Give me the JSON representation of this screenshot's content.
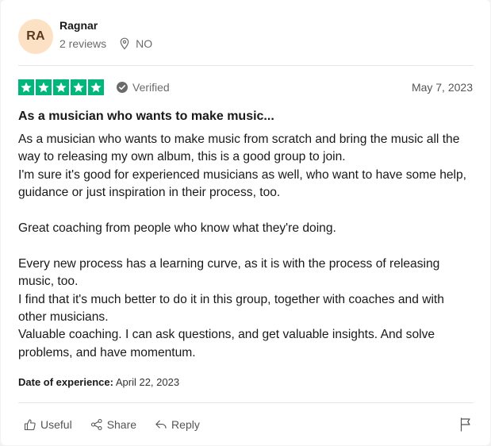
{
  "reviewer": {
    "initials": "RA",
    "name": "Ragnar",
    "reviews_count": "2 reviews",
    "country": "NO",
    "avatar_bg": "#fde1c4"
  },
  "rating": {
    "stars": 5,
    "star_color": "#00b67a",
    "verified_label": "Verified",
    "date": "May 7, 2023"
  },
  "review": {
    "title": "As a musician who wants to make music...",
    "paragraphs": [
      "As a musician who wants to make music from scratch and bring the music all the way to releasing my own album, this is a good group to join.",
      "I'm sure it's good for experienced musicians as well, who want to have some help, guidance or just inspiration in their process, too.",
      "",
      "Great coaching from people who know what they're doing.",
      "",
      "Every new process has a learning curve, as it is with the process of releasing music, too.",
      "I find that it's much better to do it in this group, together with coaches and with other musicians.",
      "Valuable coaching. I can ask questions, and get valuable insights. And solve problems, and have momentum."
    ]
  },
  "experience": {
    "label": "Date of experience:",
    "date": "April 22, 2023"
  },
  "actions": {
    "useful": "Useful",
    "share": "Share",
    "reply": "Reply"
  },
  "icons": {
    "location": "location-pin-icon",
    "verified": "check-circle-icon",
    "useful": "thumbs-up-icon",
    "share": "share-icon",
    "reply": "reply-icon",
    "flag": "flag-icon"
  }
}
